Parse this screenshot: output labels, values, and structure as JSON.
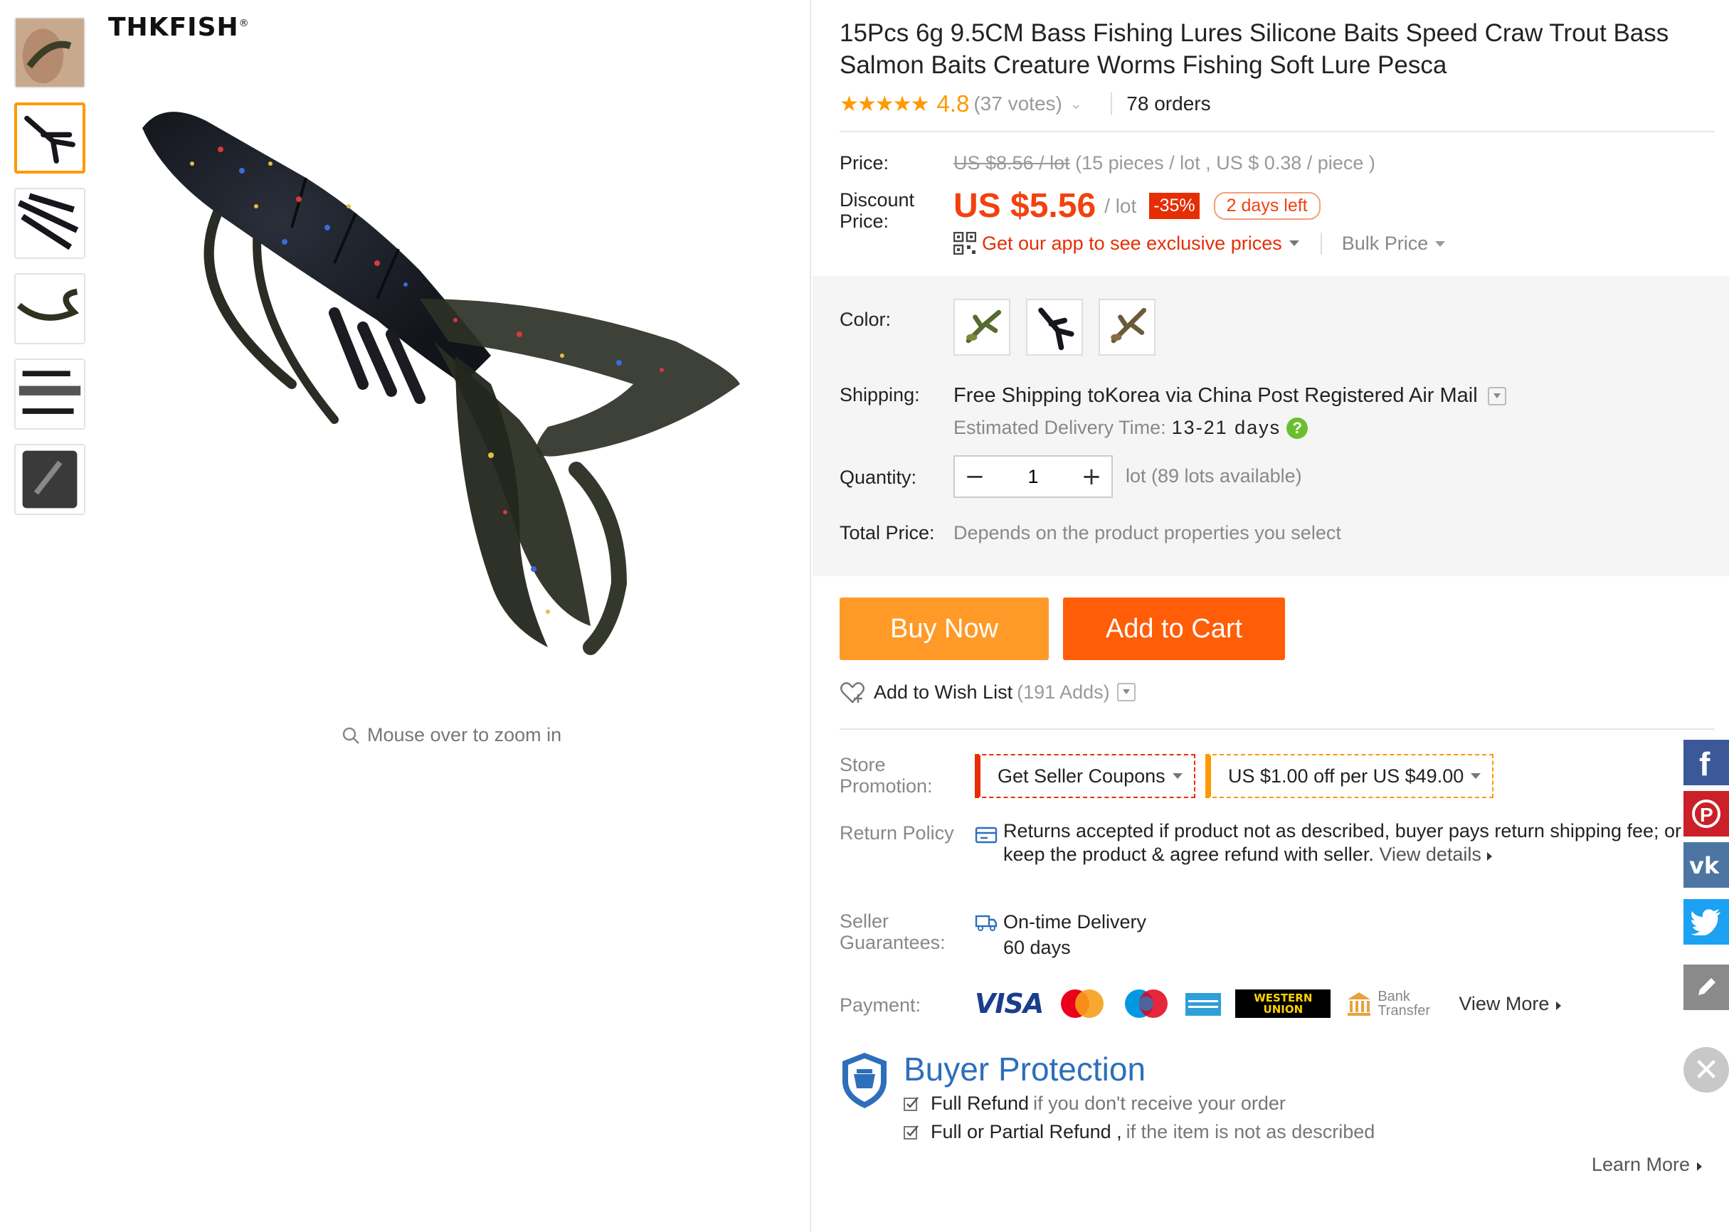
{
  "brand": {
    "name": "THKFISH",
    "mark": "®"
  },
  "gallery": {
    "zoom_hint": "Mouse over to zoom in",
    "thumbnails": [
      "thumb-hand",
      "thumb-black-craw",
      "thumb-cluster",
      "thumb-side",
      "thumb-ruler",
      "thumb-scale"
    ],
    "active_index": 1
  },
  "product": {
    "title": "15Pcs 6g 9.5CM Bass Fishing Lures Silicone Baits Speed Craw Trout Bass Salmon Baits Creature Worms Fishing Soft Lure Pesca",
    "rating": "4.8",
    "stars": "★★★★★",
    "votes": "(37 votes)",
    "orders": "78 orders"
  },
  "price": {
    "label": "Price:",
    "old": "US $8.56 / lot",
    "old_detail": " (15 pieces / lot , US $ 0.38 / piece )",
    "discount_label": "Discount Price:",
    "new": "US $5.56",
    "per_lot": "/ lot",
    "off": "-35%",
    "days_left": "2 days left",
    "app_link": "Get our app to see exclusive prices",
    "bulk": "Bulk Price"
  },
  "options": {
    "color_label": "Color:",
    "shipping_label": "Shipping:",
    "shipping_free": "Free Shipping to",
    "shipping_rest": " Korea via China Post Registered Air Mail",
    "delivery_label": "Estimated Delivery Time:",
    "delivery_value": "13-21 days",
    "help_glyph": "?",
    "quantity_label": "Quantity:",
    "quantity_value": "1",
    "minus": "−",
    "plus": "+",
    "qty_available": "lot (89 lots available)",
    "total_label": "Total Price:",
    "total_note": "Depends on the product properties you select"
  },
  "actions": {
    "buy_now": "Buy Now",
    "add_to_cart": "Add to Cart",
    "wish_list": "Add to Wish List",
    "wish_adds": "(191 Adds)"
  },
  "store": {
    "promotion_label": "Store Promotion:",
    "coupon_seller": "Get Seller Coupons",
    "coupon_discount": "US $1.00 off per US $49.00",
    "return_label": "Return Policy",
    "return_text": "Returns accepted if product not as described, buyer pays return shipping fee; or keep the product & agree refund with seller.",
    "return_link": "View details",
    "guarantee_label": "Seller Guarantees:",
    "guarantee_title": "On-time Delivery",
    "guarantee_days": "60 days",
    "payment_label": "Payment:",
    "pay_visa": "VISA",
    "pay_wu": "WESTERN UNION",
    "pay_bank": "Bank Transfer",
    "pay_more": "View More"
  },
  "protection": {
    "title": "Buyer Protection",
    "item1_strong": "Full Refund",
    "item1_rest": "if you don't receive your order",
    "item2_strong": "Full or Partial Refund ,",
    "item2_rest": "if the item is not as described",
    "learn_more": "Learn More"
  },
  "social": {
    "facebook": "f",
    "pinterest": "P",
    "vk": "vk",
    "colors": {
      "facebook": "#3b5998",
      "pinterest": "#cb2027",
      "vk": "#4c75a3",
      "twitter": "#1da1f2",
      "edit": "#8a8a8a"
    }
  },
  "colors": {
    "accent": "#ff9900",
    "price": "#f2410f",
    "cart": "#ff5d08",
    "buy": "#ff9a28",
    "protection": "#2d6fbb"
  }
}
